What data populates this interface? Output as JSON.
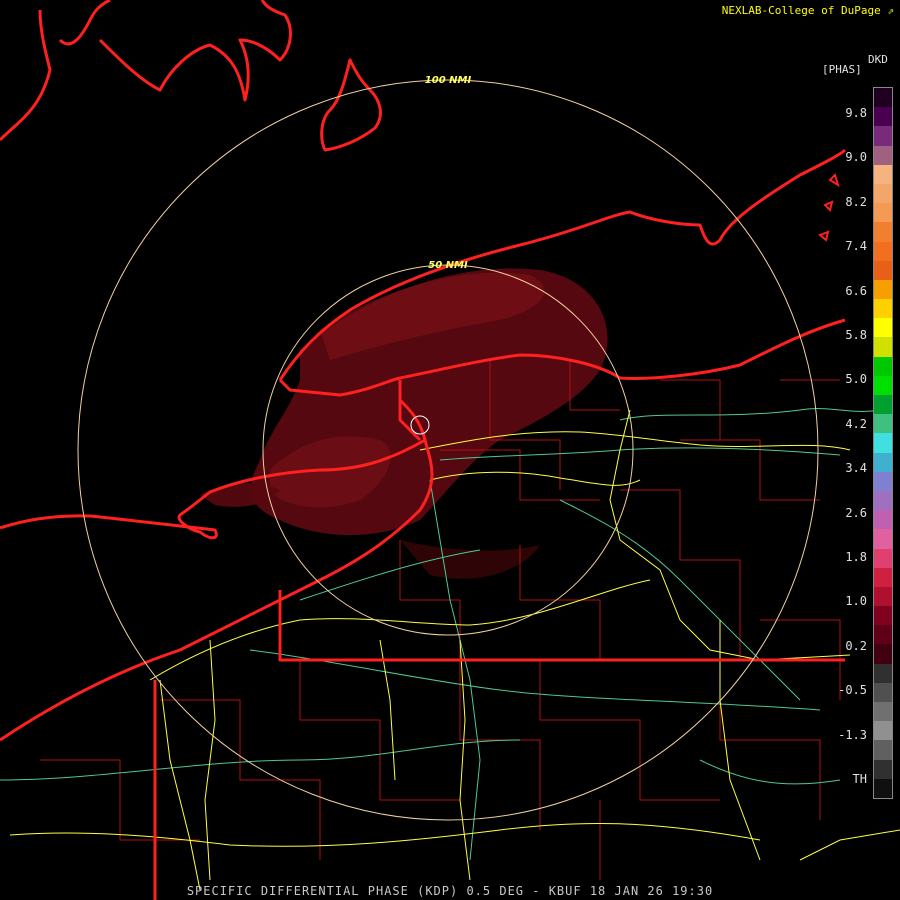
{
  "header": {
    "credit": "NEXLAB-College of DuPage"
  },
  "footer": {
    "caption": "SPECIFIC DIFFERENTIAL PHASE (KDP) 0.5 DEG - KBUF 18 JAN 26 19:30"
  },
  "range_rings": [
    {
      "label": "100 NMI"
    },
    {
      "label": "50 NMI"
    }
  ],
  "legend": {
    "product": "DKD",
    "units": "[PHAS]",
    "ticks": [
      "9.8",
      "9.0",
      "8.2",
      "7.4",
      "6.6",
      "5.8",
      "5.0",
      "4.2",
      "3.4",
      "2.6",
      "1.8",
      "1.0",
      "0.2",
      "-0.5",
      "-1.3",
      "TH"
    ],
    "colors": [
      "#200020",
      "#4a0050",
      "#7a2a7a",
      "#a06080",
      "#f7b37f",
      "#f3a66a",
      "#f39a55",
      "#f08030",
      "#f07020",
      "#e86018",
      "#f5a000",
      "#ffd000",
      "#ffff00",
      "#d0e000",
      "#00c800",
      "#00e000",
      "#00a030",
      "#40c080",
      "#40e0e0",
      "#40b0d0",
      "#8080d0",
      "#a070c0",
      "#c060b0",
      "#e060a0",
      "#e04070",
      "#d02040",
      "#b01030",
      "#800020",
      "#600018",
      "#400010",
      "#303030",
      "#505050",
      "#707070",
      "#909090",
      "#606060",
      "#303030",
      "#101010"
    ]
  },
  "colors": {
    "background": "#000000",
    "coast_state": "#ff2020",
    "county": "#c01010",
    "interstate": "#ffff40",
    "highway": "#60d0a0",
    "ring": "#f0d0a0",
    "echo": "#6a0a10"
  }
}
